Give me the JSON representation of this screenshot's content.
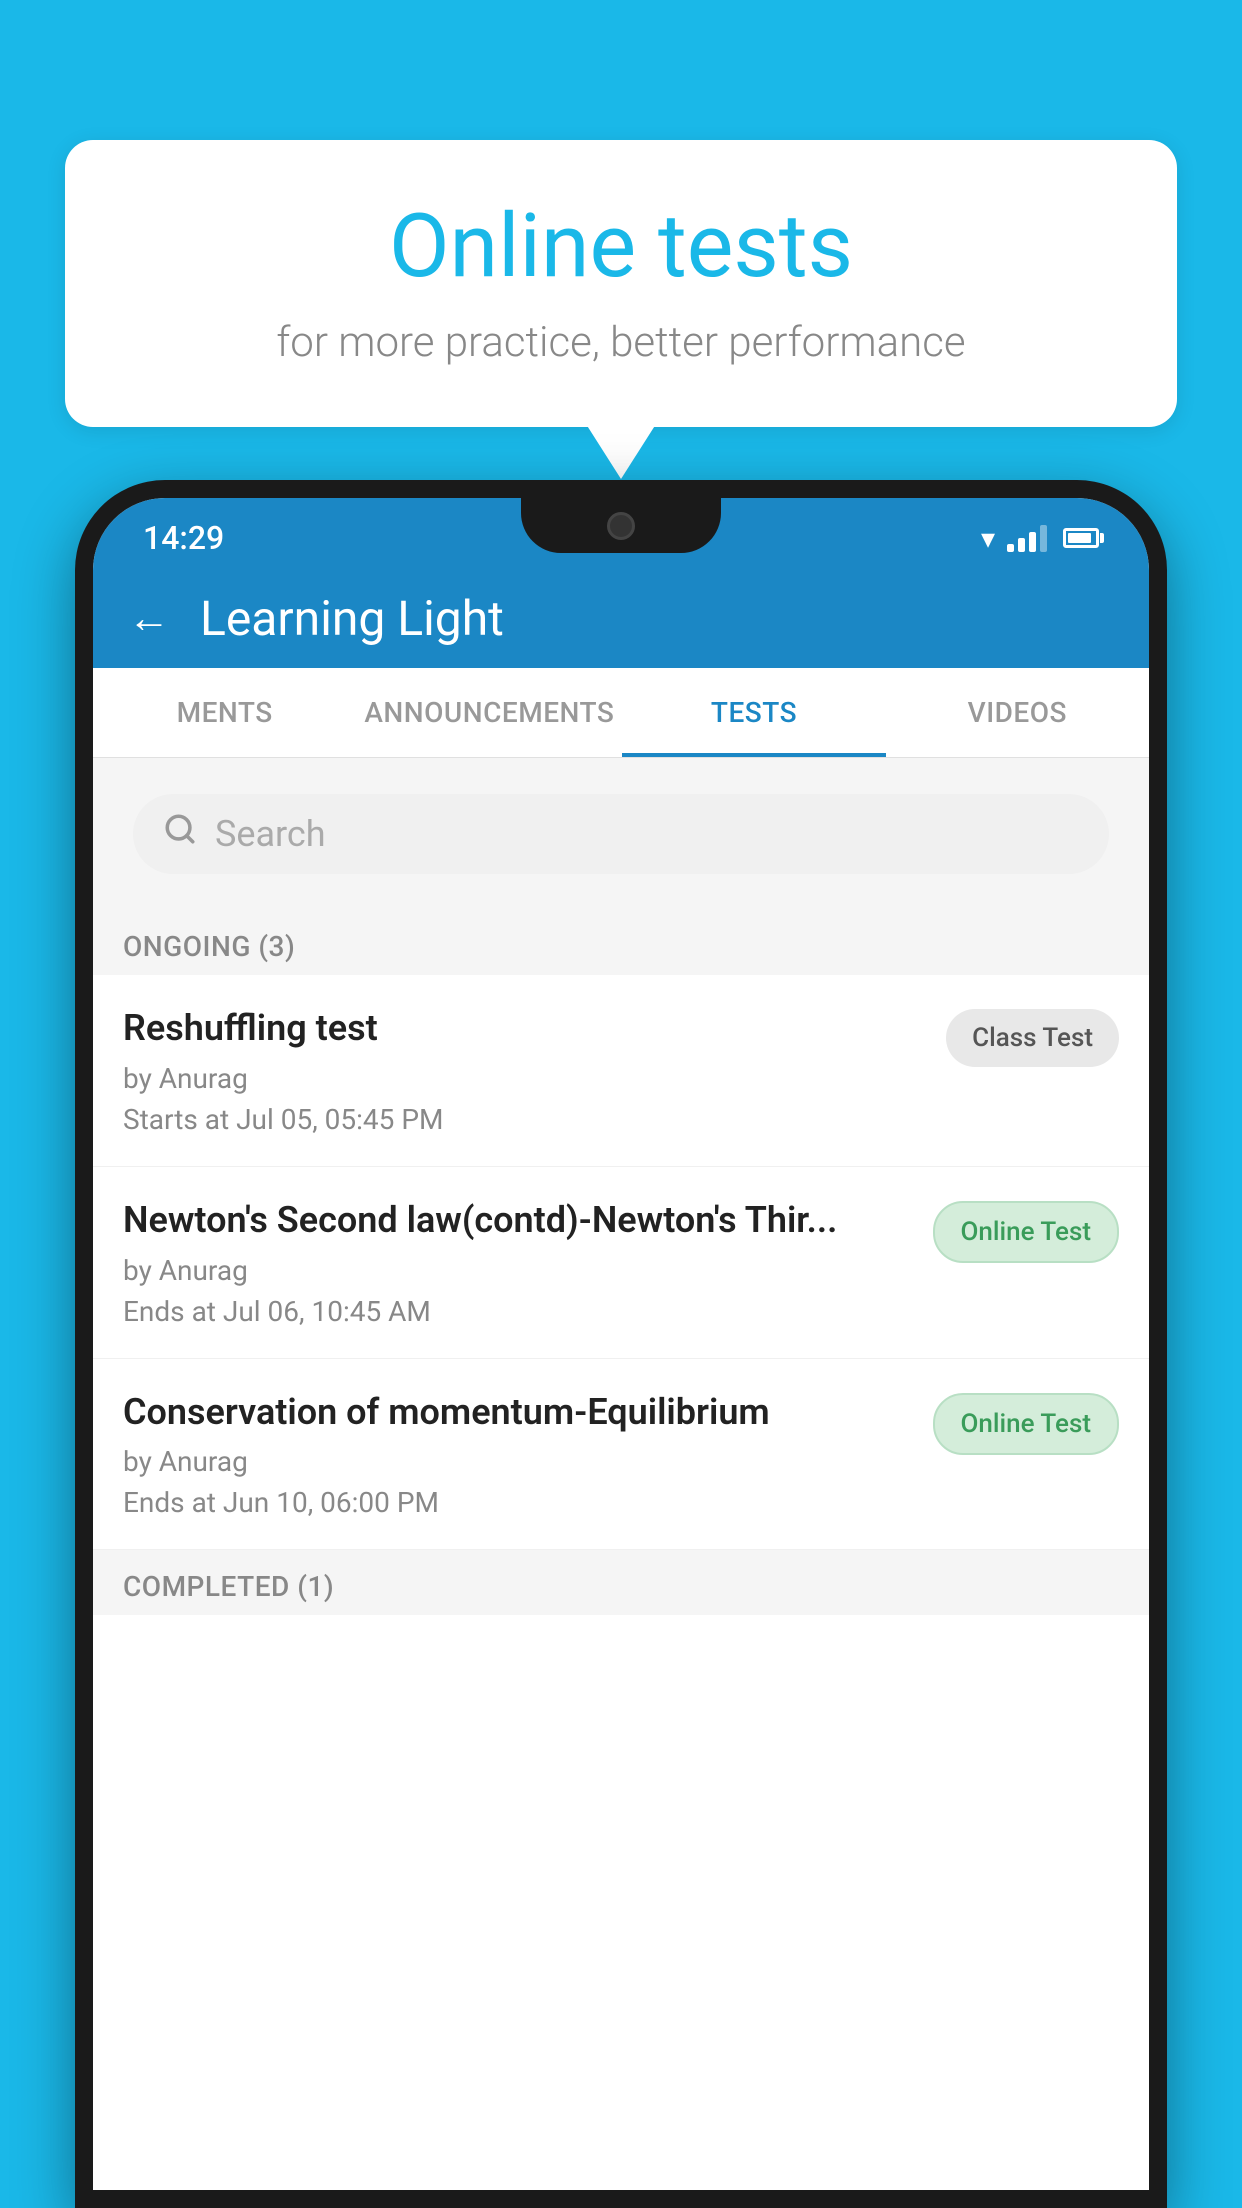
{
  "background_color": "#1ab8e8",
  "speech_bubble": {
    "title": "Online tests",
    "subtitle": "for more practice, better performance"
  },
  "status_bar": {
    "time": "14:29"
  },
  "app_bar": {
    "title": "Learning Light",
    "back_label": "←"
  },
  "tabs": [
    {
      "label": "MENTS",
      "active": false
    },
    {
      "label": "ANNOUNCEMENTS",
      "active": false
    },
    {
      "label": "TESTS",
      "active": true
    },
    {
      "label": "VIDEOS",
      "active": false
    }
  ],
  "search": {
    "placeholder": "Search"
  },
  "ongoing_section": {
    "header": "ONGOING (3)"
  },
  "test_items": [
    {
      "title": "Reshuffling test",
      "author": "by Anurag",
      "time_label": "Starts at",
      "time": "Jul 05, 05:45 PM",
      "badge": "Class Test",
      "badge_type": "class"
    },
    {
      "title": "Newton's Second law(contd)-Newton's Thir...",
      "author": "by Anurag",
      "time_label": "Ends at",
      "time": "Jul 06, 10:45 AM",
      "badge": "Online Test",
      "badge_type": "online"
    },
    {
      "title": "Conservation of momentum-Equilibrium",
      "author": "by Anurag",
      "time_label": "Ends at",
      "time": "Jun 10, 06:00 PM",
      "badge": "Online Test",
      "badge_type": "online"
    }
  ],
  "completed_section": {
    "header": "COMPLETED (1)"
  }
}
